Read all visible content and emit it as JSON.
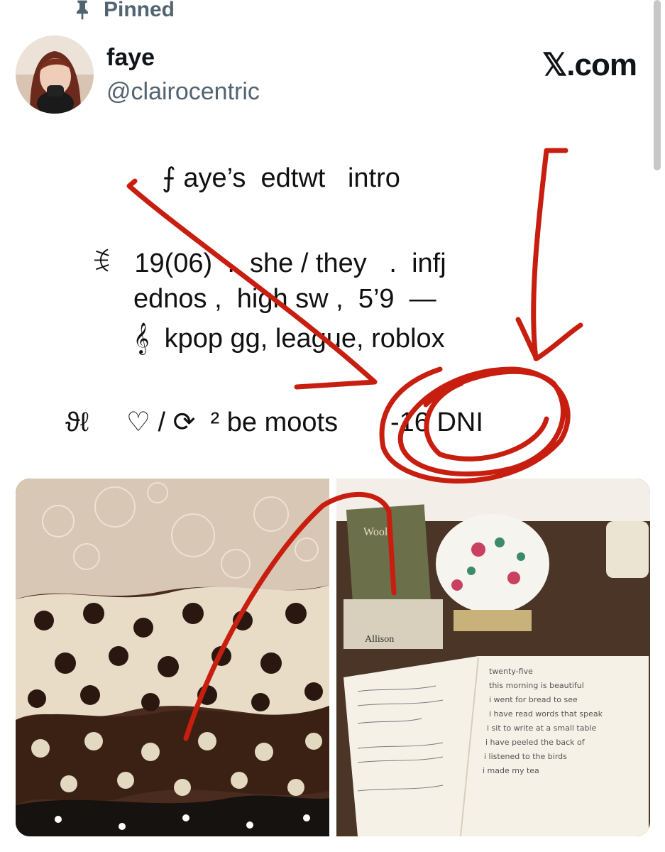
{
  "post": {
    "pinned_label": "Pinned",
    "author": {
      "display_name": "faye",
      "handle": "@clairocentric"
    },
    "brand": "𝕏.com",
    "lines": [
      "⨍ aye’s  edtwt   intro",
      "ꉂ   19(06)  .  she / they   .  infj",
      "ednos ,  high sw ,  5’9  —",
      "𝄞  kpop gg, league, roblox",
      "ϑℓ     ♡ / ⟳  ² be moots       -16 DNI"
    ],
    "journal_text": [
      "twenty-five",
      "this morning is beautiful",
      "i went for bread to see",
      "i have read words that speak",
      "i sit to write at a small table",
      "i have peeled the back of",
      "i listened to the birds",
      "i made my tea"
    ],
    "book_text": [
      "Woolf",
      "Allison"
    ]
  },
  "colors": {
    "annotation": "#c81e10",
    "handle": "#536471",
    "text": "#0f1419"
  },
  "icons": {
    "pin": "pin-icon",
    "avatar": "avatar",
    "brand": "x-logo"
  }
}
